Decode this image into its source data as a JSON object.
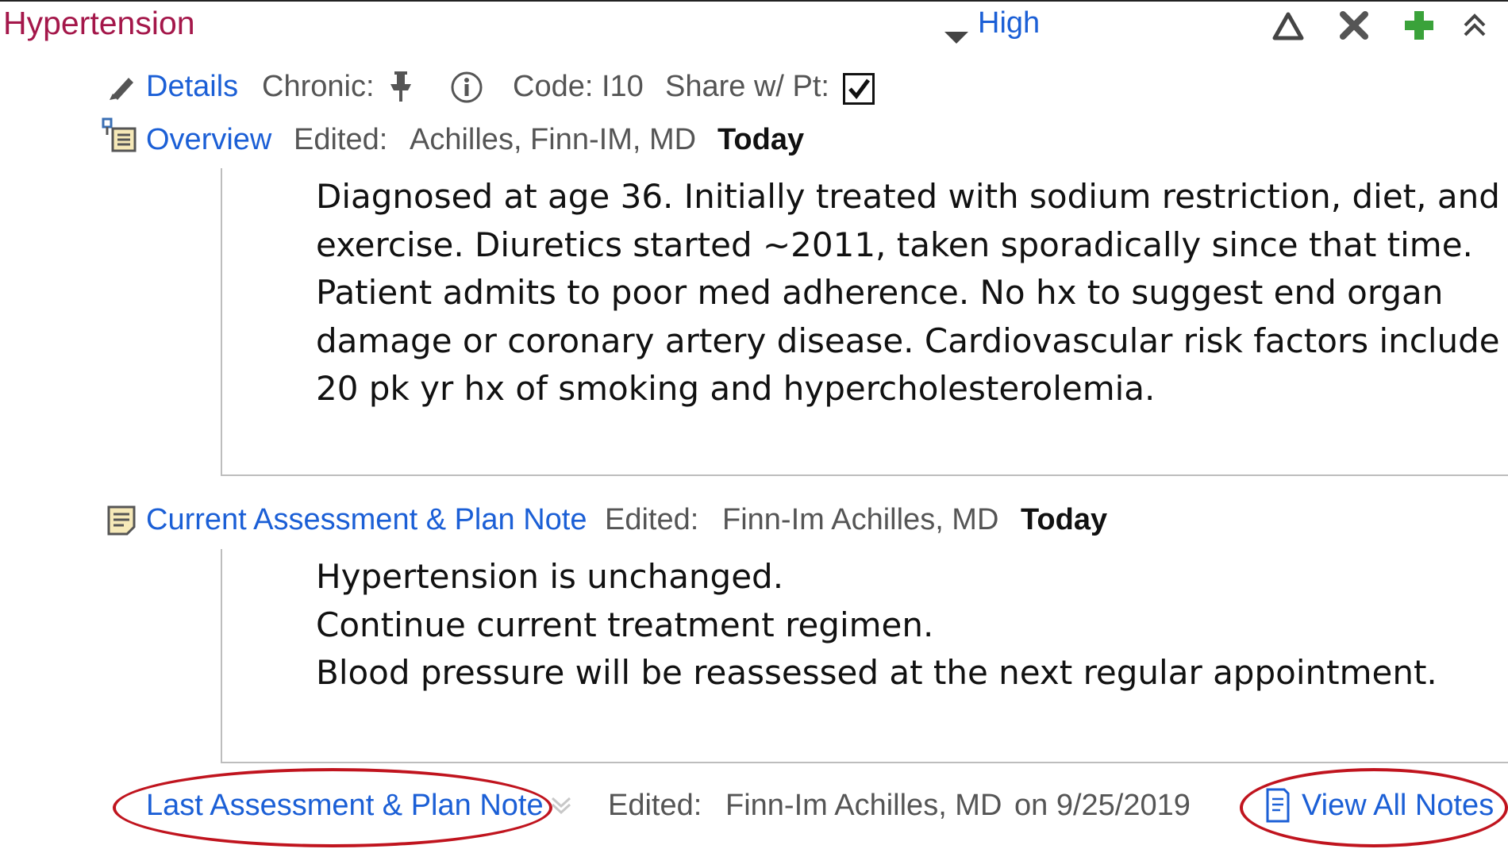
{
  "problem": {
    "title": "Hypertension",
    "priority": "High"
  },
  "toolbar": {
    "icons": [
      "triangle-up-icon",
      "close-icon",
      "add-icon",
      "collapse-up-icon"
    ],
    "colors": {
      "add": "#3aa23a",
      "title": "#a4174a",
      "link": "#1b5fd6",
      "highlight_oval": "#c0141e"
    }
  },
  "details_row": {
    "details_label": "Details",
    "chronic_label": "Chronic:",
    "code_label": "Code: I10",
    "share_label": "Share w/ Pt:",
    "share_checked": true
  },
  "overview": {
    "link": "Overview",
    "edited_label": "Edited:",
    "author": "Achilles, Finn-IM, MD",
    "date": "Today",
    "lines": [
      "Diagnosed at age 36. Initially treated with sodium restriction, diet, and",
      "exercise. Diuretics started ~2011, taken sporadically since that time.",
      "Patient admits to poor med adherence. No hx to suggest end organ",
      "damage or coronary artery disease. Cardiovascular risk factors include",
      "20 pk yr hx of smoking and hypercholesterolemia."
    ]
  },
  "current_note": {
    "link": "Current Assessment & Plan Note",
    "edited_label": "Edited:",
    "author": "Finn-Im Achilles, MD",
    "date": "Today",
    "lines": [
      "Hypertension is unchanged.",
      "Continue current treatment regimen.",
      "Blood pressure will be reassessed at the next regular appointment."
    ]
  },
  "last_note": {
    "link": "Last Assessment & Plan Note",
    "edited_label": "Edited:",
    "author": "Finn-Im Achilles, MD",
    "date": "on 9/25/2019",
    "view_all": "View All Notes"
  }
}
